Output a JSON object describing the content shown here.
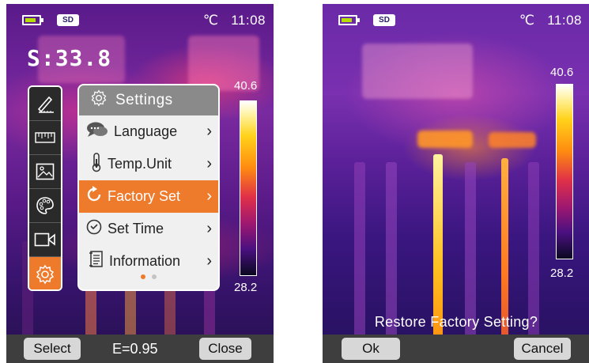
{
  "left_screen": {
    "status": {
      "sd_label": "SD",
      "unit": "℃",
      "time": "11:08"
    },
    "spot_reading": "S:33.8",
    "scale": {
      "max": "40.6",
      "min": "28.2"
    },
    "icons": [
      {
        "name": "measure-tool-icon",
        "active": false
      },
      {
        "name": "ruler-icon",
        "active": false
      },
      {
        "name": "image-icon",
        "active": false
      },
      {
        "name": "palette-icon",
        "active": false
      },
      {
        "name": "video-icon",
        "active": false
      },
      {
        "name": "settings-icon",
        "active": true
      }
    ],
    "settings_menu": {
      "title": "Settings",
      "items": [
        {
          "label": "Language",
          "icon": "speech-bubble-icon",
          "selected": false
        },
        {
          "label": "Temp.Unit",
          "icon": "thermometer-icon",
          "selected": false
        },
        {
          "label": "Factory Set",
          "icon": "reset-icon",
          "selected": true
        },
        {
          "label": "Set Time",
          "icon": "clock-icon",
          "selected": false
        },
        {
          "label": "Information",
          "icon": "document-icon",
          "selected": false
        }
      ],
      "page_indicator": {
        "current": 1,
        "total": 2
      }
    },
    "bottom_bar": {
      "left_button": "Select",
      "emissivity": "E=0.95",
      "right_button": "Close"
    }
  },
  "right_screen": {
    "status": {
      "sd_label": "SD",
      "unit": "℃",
      "time": "11:08"
    },
    "scale": {
      "max": "40.6",
      "min": "28.2"
    },
    "prompt": "Restore Factory Setting?",
    "bottom_bar": {
      "left_button": "Ok",
      "right_button": "Cancel"
    }
  },
  "colors": {
    "accent": "#ee7a2c",
    "panel_bg": "#f0f0f0",
    "header_bg": "#8a8a8a",
    "bottom_bar_bg": "#3e3e3e",
    "button_bg": "#d7d7d7",
    "battery_fill": "#b6e000"
  }
}
